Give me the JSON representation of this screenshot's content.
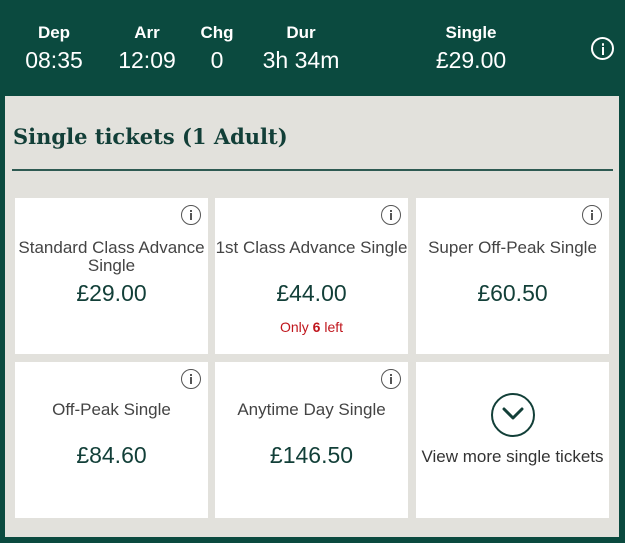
{
  "journey": {
    "dep_label": "Dep",
    "dep_value": "08:35",
    "arr_label": "Arr",
    "arr_value": "12:09",
    "chg_label": "Chg",
    "chg_value": "0",
    "dur_label": "Dur",
    "dur_value": "3h 34m",
    "fare_label": "Single",
    "fare_value": "£29.00"
  },
  "section": {
    "title": "Single tickets (1 Adult)"
  },
  "tickets": [
    {
      "name": "Standard Class Advance Single",
      "price": "£29.00"
    },
    {
      "name": "1st Class Advance Single",
      "price": "£44.00",
      "availability_prefix": "Only",
      "availability_count": "6",
      "availability_suffix": "left"
    },
    {
      "name": "Super Off-Peak Single",
      "price": "£60.50"
    },
    {
      "name": "Off-Peak Single",
      "price": "£84.60"
    },
    {
      "name": "Anytime Day Single",
      "price": "£146.50"
    }
  ],
  "view_more": {
    "label": "View more single tickets"
  },
  "colors": {
    "header_bg": "#0b4a3f",
    "panel_bg": "#e2e1dc",
    "accent": "#123f38",
    "warning": "#c0161d"
  },
  "icons": {
    "info": "info-icon",
    "expand": "chevron-down-icon"
  }
}
